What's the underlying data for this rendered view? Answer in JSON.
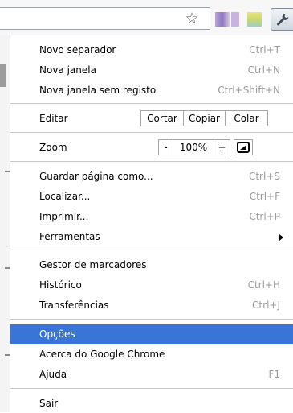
{
  "toolbar": {
    "star_icon": "star-outline-icon",
    "wrench_icon": "wrench-icon"
  },
  "menu": {
    "items_top": [
      {
        "label": "Novo separador",
        "shortcut": "Ctrl+T"
      },
      {
        "label": "Nova janela",
        "shortcut": "Ctrl+N"
      },
      {
        "label": "Nova janela sem registo",
        "shortcut": "Ctrl+Shift+N"
      }
    ],
    "edit": {
      "label": "Editar",
      "cut": "Cortar",
      "copy": "Copiar",
      "paste": "Colar"
    },
    "zoom": {
      "label": "Zoom",
      "minus": "-",
      "value": "100%",
      "plus": "+"
    },
    "items_page": [
      {
        "label": "Guardar página como...",
        "shortcut": "Ctrl+S"
      },
      {
        "label": "Localizar...",
        "shortcut": "Ctrl+F"
      },
      {
        "label": "Imprimir...",
        "shortcut": "Ctrl+P"
      },
      {
        "label": "Ferramentas",
        "shortcut": ""
      }
    ],
    "items_history": [
      {
        "label": "Gestor de marcadores",
        "shortcut": ""
      },
      {
        "label": "Histórico",
        "shortcut": "Ctrl+H"
      },
      {
        "label": "Transferências",
        "shortcut": "Ctrl+J"
      }
    ],
    "items_help": [
      {
        "label": "Opções",
        "shortcut": "",
        "selected": true
      },
      {
        "label": "Acerca do Google Chrome",
        "shortcut": ""
      },
      {
        "label": "Ajuda",
        "shortcut": "F1"
      }
    ],
    "exit": {
      "label": "Sair"
    }
  },
  "colors": {
    "selection": "#3875d7",
    "shortcut_text": "#9b9b9b",
    "separator": "#c6c6c6"
  }
}
